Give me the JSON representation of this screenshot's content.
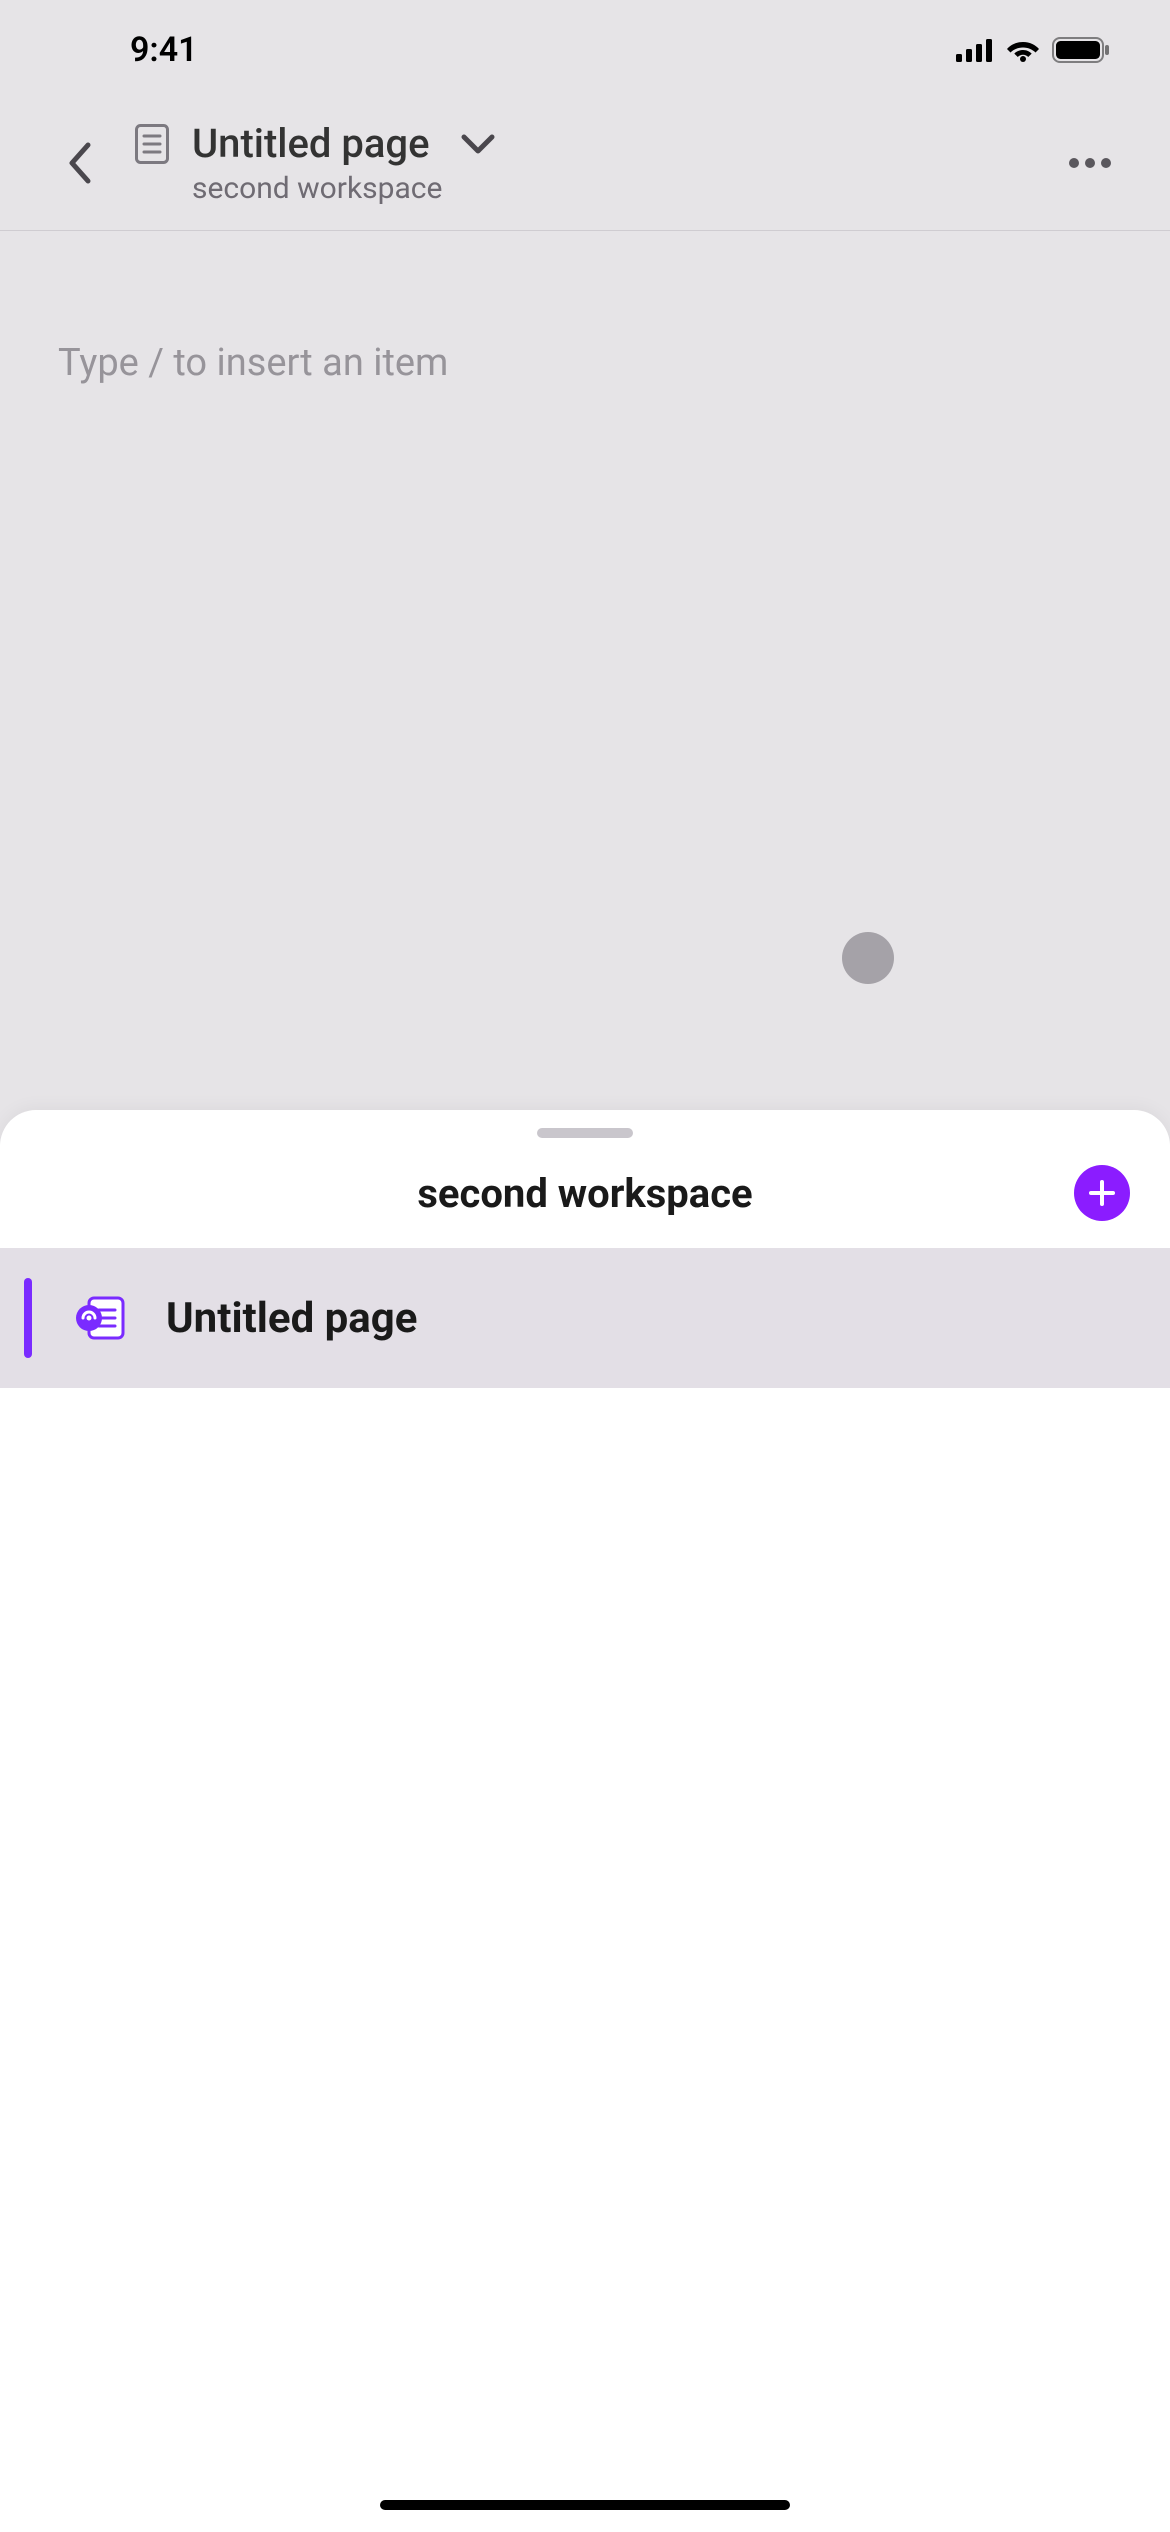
{
  "status_bar": {
    "time": "9:41"
  },
  "header": {
    "page_title": "Untitled page",
    "workspace_name": "second workspace"
  },
  "editor": {
    "placeholder": "Type / to insert an item"
  },
  "sheet": {
    "title": "second workspace",
    "items": [
      {
        "label": "Untitled page",
        "active": true
      }
    ]
  },
  "colors": {
    "accent": "#8b1cff",
    "indicator": "#7a2bff"
  }
}
